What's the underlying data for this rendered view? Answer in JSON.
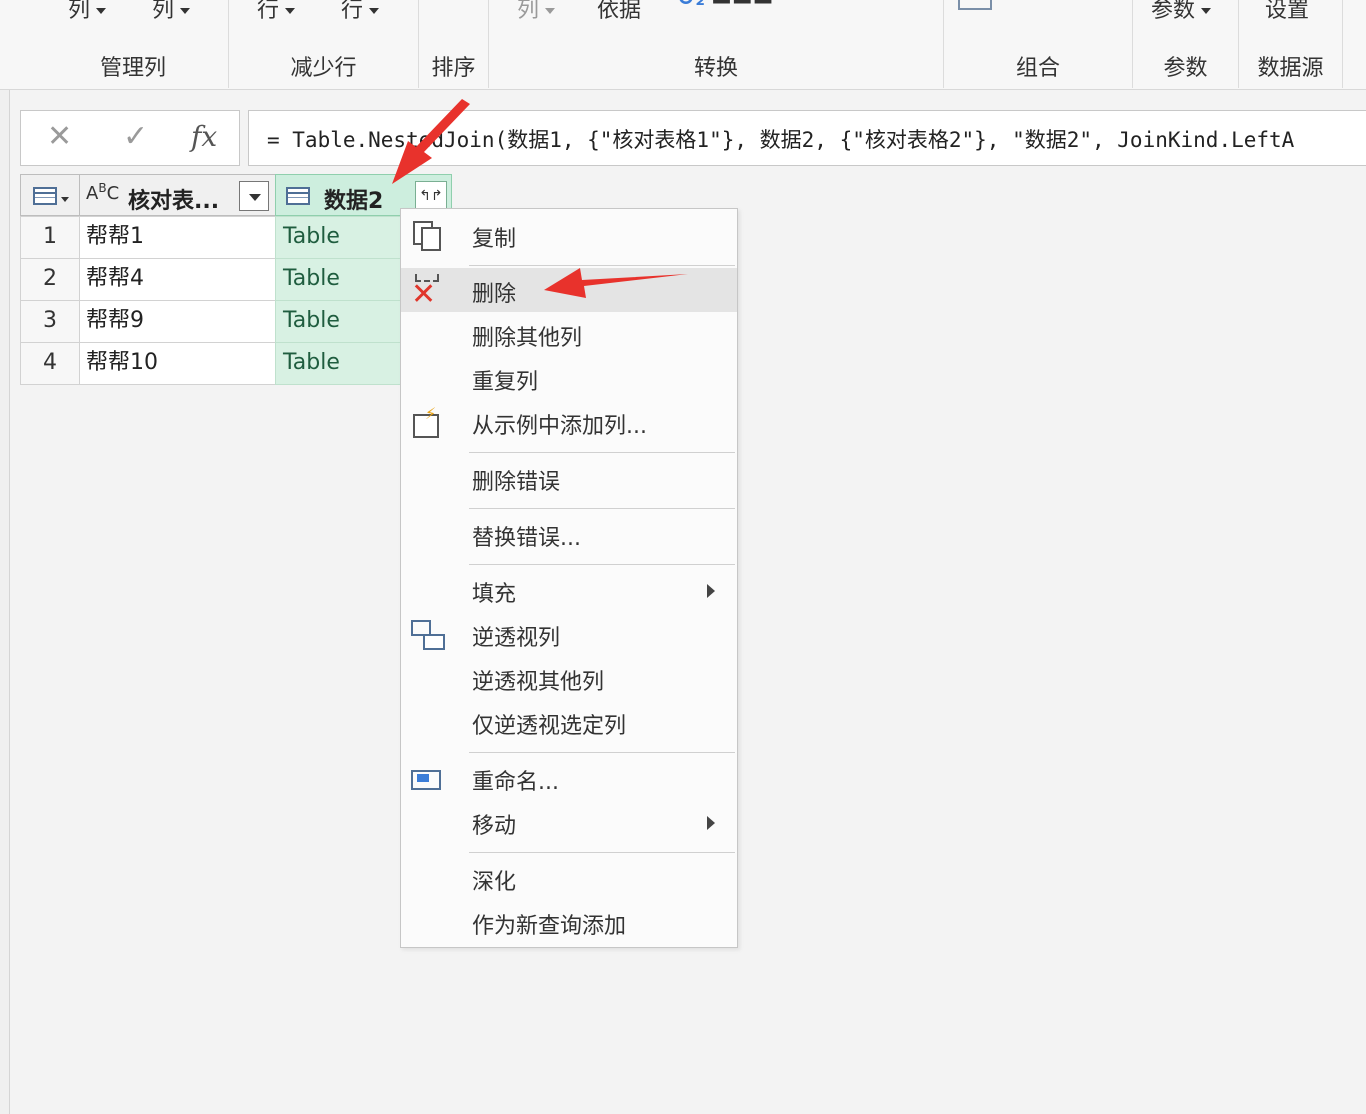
{
  "ribbon": {
    "groups": [
      {
        "title": "管理列",
        "buttons": [
          "列",
          "列"
        ]
      },
      {
        "title": "减少行",
        "buttons": [
          "行",
          "行"
        ]
      },
      {
        "title": "排序"
      },
      {
        "title": "转换",
        "buttons": [
          "列",
          "依据"
        ]
      },
      {
        "title": "组合"
      },
      {
        "title": "参数",
        "buttons": [
          "参数"
        ]
      },
      {
        "title": "数据源",
        "buttons": [
          "设置"
        ]
      }
    ]
  },
  "formula_bar": {
    "cancel_icon": "close-icon",
    "confirm_icon": "check-icon",
    "fx_label": "fx",
    "formula": "= Table.NestedJoin(数据1, {\"核对表格1\"}, 数据2, {\"核对表格2\"}, \"数据2\", JoinKind.LeftA"
  },
  "grid": {
    "columns": [
      {
        "type_label": "ABC",
        "name": "核对表..."
      },
      {
        "name": "数据2"
      }
    ],
    "rows": [
      {
        "num": "1",
        "a": "帮帮1",
        "b": "Table"
      },
      {
        "num": "2",
        "a": "帮帮4",
        "b": "Table"
      },
      {
        "num": "3",
        "a": "帮帮9",
        "b": "Table"
      },
      {
        "num": "4",
        "a": "帮帮10",
        "b": "Table"
      }
    ]
  },
  "context_menu": {
    "items": [
      {
        "label": "复制",
        "icon": "copy-icon"
      },
      {
        "label": "删除",
        "icon": "delete-icon",
        "highlighted": true
      },
      {
        "label": "删除其他列"
      },
      {
        "label": "重复列"
      },
      {
        "label": "从示例中添加列...",
        "icon": "flash-fill-icon"
      },
      {
        "label": "删除错误"
      },
      {
        "label": "替换错误..."
      },
      {
        "label": "填充",
        "submenu": true
      },
      {
        "label": "逆透视列",
        "icon": "unpivot-icon"
      },
      {
        "label": "逆透视其他列"
      },
      {
        "label": "仅逆透视选定列"
      },
      {
        "label": "重命名...",
        "icon": "rename-icon"
      },
      {
        "label": "移动",
        "submenu": true
      },
      {
        "label": "深化"
      },
      {
        "label": "作为新查询添加"
      }
    ]
  },
  "colors": {
    "selected_column": "#cdeede",
    "annotation_arrow": "#e8322c",
    "delete_icon": "#e0362c"
  }
}
